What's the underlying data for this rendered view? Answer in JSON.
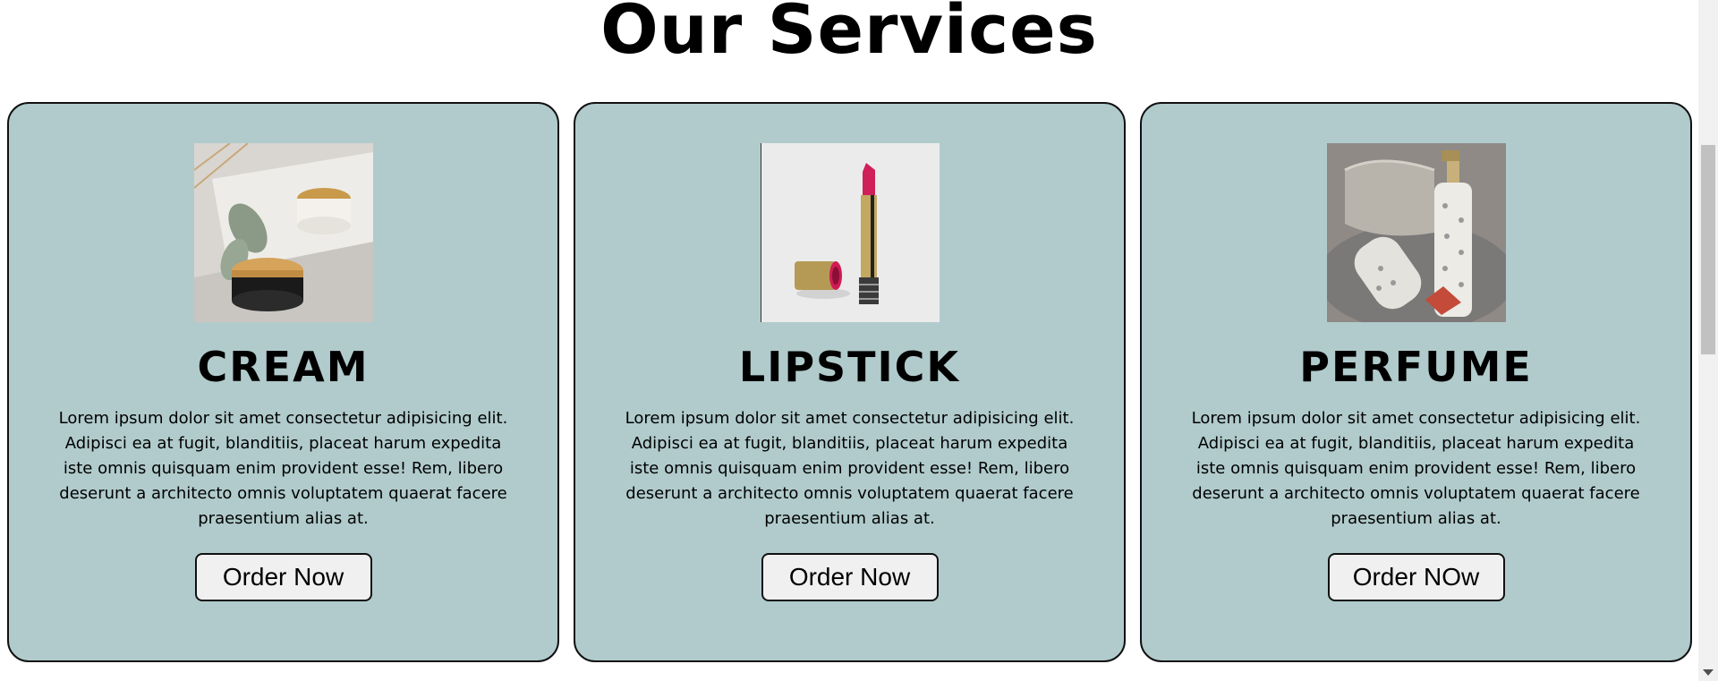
{
  "heading": "Our Services",
  "colors": {
    "card_background": "#b1cbcc",
    "button_background": "#f0f0f0",
    "border": "#111111"
  },
  "cards": [
    {
      "title": "CREAM",
      "image_icon": "cream-jars-image",
      "text": "Lorem ipsum dolor sit amet consectetur adipisicing elit. Adipisci ea at fugit, blanditiis, placeat harum expedita iste omnis quisquam enim provident esse! Rem, libero deserunt a architecto omnis voluptatem quaerat facere praesentium alias at.",
      "button_label": "Order Now"
    },
    {
      "title": "LIPSTICK",
      "image_icon": "lipstick-image",
      "text": "Lorem ipsum dolor sit amet consectetur adipisicing elit. Adipisci ea at fugit, blanditiis, placeat harum expedita iste omnis quisquam enim provident esse! Rem, libero deserunt a architecto omnis voluptatem quaerat facere praesentium alias at.",
      "button_label": "Order Now"
    },
    {
      "title": "PERFUME",
      "image_icon": "perfume-bottles-image",
      "text": "Lorem ipsum dolor sit amet consectetur adipisicing elit. Adipisci ea at fugit, blanditiis, placeat harum expedita iste omnis quisquam enim provident esse! Rem, libero deserunt a architecto omnis voluptatem quaerat facere praesentium alias at.",
      "button_label": "Order NOw"
    }
  ]
}
